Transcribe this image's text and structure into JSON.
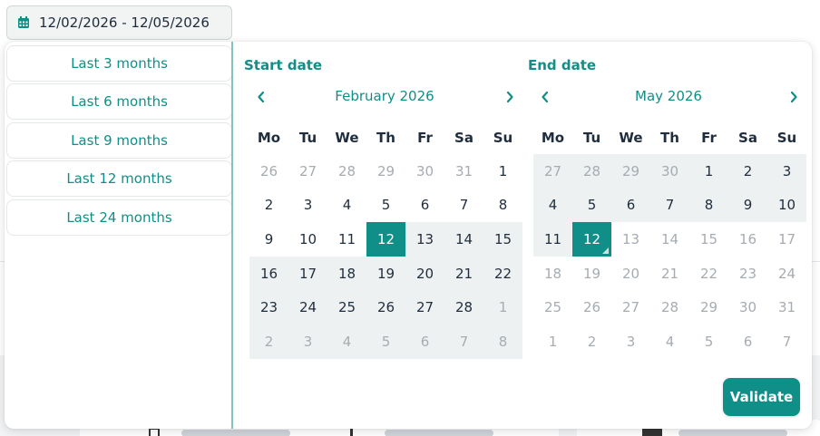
{
  "date_input": {
    "value": "12/02/2026 - 12/05/2026",
    "icon": "calendar-icon"
  },
  "presets": [
    {
      "label": "Last 3 months"
    },
    {
      "label": "Last 6 months"
    },
    {
      "label": "Last 9 months"
    },
    {
      "label": "Last 12 months"
    },
    {
      "label": "Last 24 months"
    }
  ],
  "start_calendar": {
    "title": "Start date",
    "month": "February 2026",
    "weekdays": [
      "Mo",
      "Tu",
      "We",
      "Th",
      "Fr",
      "Sa",
      "Su"
    ],
    "weeks": [
      [
        [
          "26",
          "out"
        ],
        [
          "27",
          "out"
        ],
        [
          "28",
          "out"
        ],
        [
          "29",
          "out"
        ],
        [
          "30",
          "out"
        ],
        [
          "31",
          "out"
        ],
        [
          "1",
          ""
        ]
      ],
      [
        [
          "2",
          ""
        ],
        [
          "3",
          ""
        ],
        [
          "4",
          ""
        ],
        [
          "5",
          ""
        ],
        [
          "6",
          ""
        ],
        [
          "7",
          ""
        ],
        [
          "8",
          ""
        ]
      ],
      [
        [
          "9",
          ""
        ],
        [
          "10",
          ""
        ],
        [
          "11",
          ""
        ],
        [
          "12",
          "sel"
        ],
        [
          "13",
          "range"
        ],
        [
          "14",
          "range"
        ],
        [
          "15",
          "range"
        ]
      ],
      [
        [
          "16",
          "range"
        ],
        [
          "17",
          "range"
        ],
        [
          "18",
          "range"
        ],
        [
          "19",
          "range"
        ],
        [
          "20",
          "range"
        ],
        [
          "21",
          "range"
        ],
        [
          "22",
          "range"
        ]
      ],
      [
        [
          "23",
          "range"
        ],
        [
          "24",
          "range"
        ],
        [
          "25",
          "range"
        ],
        [
          "26",
          "range"
        ],
        [
          "27",
          "range"
        ],
        [
          "28",
          "range"
        ],
        [
          "1",
          "out range"
        ]
      ],
      [
        [
          "2",
          "out range"
        ],
        [
          "3",
          "out range"
        ],
        [
          "4",
          "out range"
        ],
        [
          "5",
          "out range"
        ],
        [
          "6",
          "out range"
        ],
        [
          "7",
          "out range"
        ],
        [
          "8",
          "out range"
        ]
      ]
    ]
  },
  "end_calendar": {
    "title": "End date",
    "month": "May 2026",
    "weekdays": [
      "Mo",
      "Tu",
      "We",
      "Th",
      "Fr",
      "Sa",
      "Su"
    ],
    "weeks": [
      [
        [
          "27",
          "out range"
        ],
        [
          "28",
          "out range"
        ],
        [
          "29",
          "out range"
        ],
        [
          "30",
          "out range"
        ],
        [
          "1",
          "range"
        ],
        [
          "2",
          "range"
        ],
        [
          "3",
          "range"
        ]
      ],
      [
        [
          "4",
          "range"
        ],
        [
          "5",
          "range"
        ],
        [
          "6",
          "range"
        ],
        [
          "7",
          "range"
        ],
        [
          "8",
          "range"
        ],
        [
          "9",
          "range"
        ],
        [
          "10",
          "range"
        ]
      ],
      [
        [
          "11",
          "range"
        ],
        [
          "12",
          "sel end"
        ],
        [
          "13",
          "out"
        ],
        [
          "14",
          "out"
        ],
        [
          "15",
          "out"
        ],
        [
          "16",
          "out"
        ],
        [
          "17",
          "out"
        ]
      ],
      [
        [
          "18",
          "out"
        ],
        [
          "19",
          "out"
        ],
        [
          "20",
          "out"
        ],
        [
          "21",
          "out"
        ],
        [
          "22",
          "out"
        ],
        [
          "23",
          "out"
        ],
        [
          "24",
          "out"
        ]
      ],
      [
        [
          "25",
          "out"
        ],
        [
          "26",
          "out"
        ],
        [
          "27",
          "out"
        ],
        [
          "28",
          "out"
        ],
        [
          "29",
          "out"
        ],
        [
          "30",
          "out"
        ],
        [
          "31",
          "out"
        ]
      ],
      [
        [
          "1",
          "out"
        ],
        [
          "2",
          "out"
        ],
        [
          "3",
          "out"
        ],
        [
          "4",
          "out"
        ],
        [
          "5",
          "out"
        ],
        [
          "6",
          "out"
        ],
        [
          "7",
          "out"
        ]
      ]
    ]
  },
  "validate_label": "Validate",
  "colors": {
    "accent": "#0f8f87",
    "range": "#eef1f1",
    "muted": "#a6acb2"
  }
}
